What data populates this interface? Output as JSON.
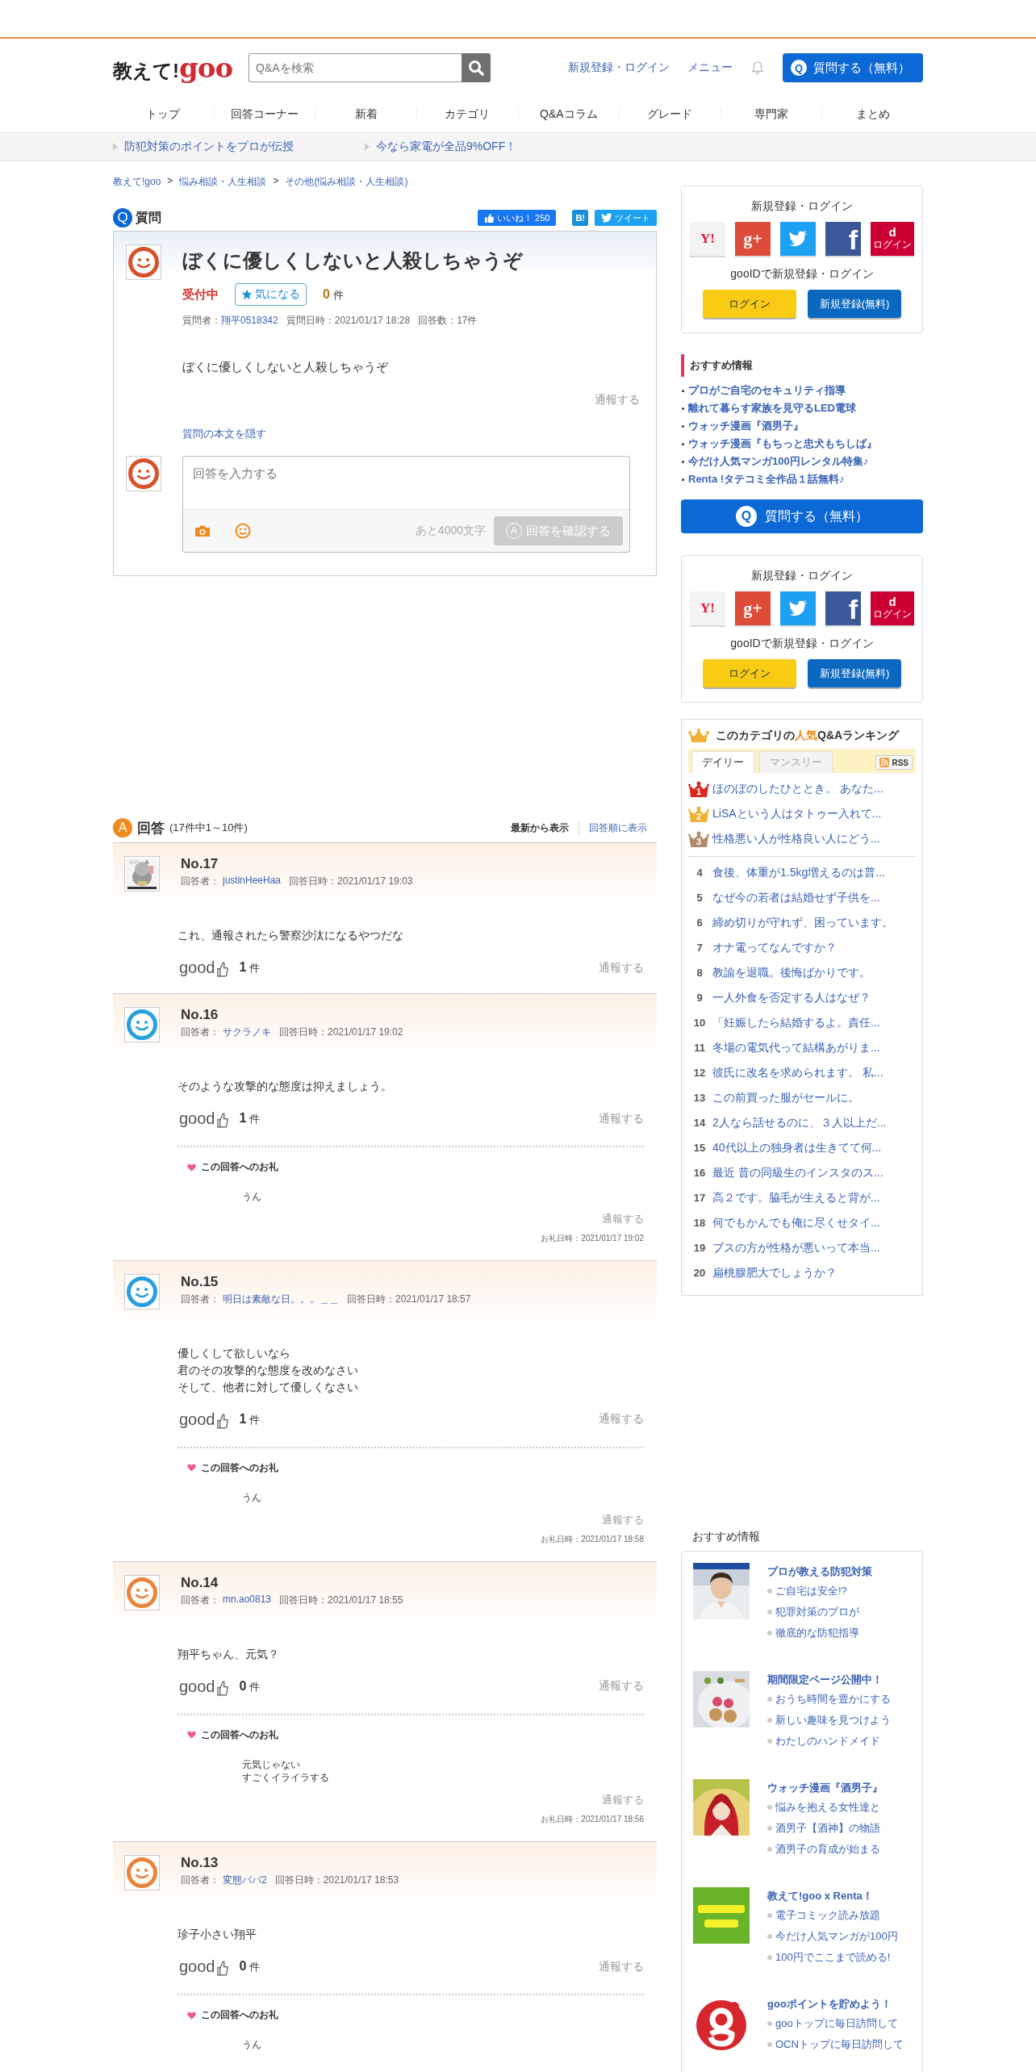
{
  "header": {
    "logo_text": "教えて!",
    "logo_brand": "goo",
    "search": {
      "placeholder": "Q&Aを検索"
    },
    "links": [
      "新規登録・ログイン",
      "メニュー"
    ],
    "ask_button": "質問する（無料）",
    "ask_icon": "Q"
  },
  "nav": [
    "トップ",
    "回答コーナー",
    "新着",
    "カテゴリ",
    "Q&Aコラム",
    "グレード",
    "専門家",
    "まとめ"
  ],
  "promos": [
    "防犯対策のポイントをプロが伝授",
    "今なら家電が全品9%OFF！"
  ],
  "breadcrumb": [
    "教えて!goo",
    "悩み相談・人生相談",
    "その他(悩み相談・人生相談)"
  ],
  "breadcrumb_separator": ">",
  "question": {
    "icon": "Q",
    "heading": "質問",
    "like_label": "いいね！",
    "like_count": "250",
    "hatena": "B!",
    "tweet": "ツイート",
    "title": "ぼくに優しくしないと人殺しちゃうぞ",
    "status": "受付中",
    "watch_label": "気になる",
    "watch_count": "0",
    "watch_unit": "件",
    "asker_label": "質問者：",
    "asker": "翔平0518342",
    "date": "質問日時：2021/01/17 18:28",
    "answer_count": "回答数：17件",
    "body": "ぼくに優しくしないと人殺しちゃうぞ",
    "report": "通報する",
    "hide_link": "質問の本文を隠す",
    "answer_box": {
      "placeholder": "回答を入力する",
      "remaining": "あと4000文字",
      "submit_icon": "A",
      "submit": "回答を確認する"
    }
  },
  "answers_header": {
    "icon": "A",
    "title": "回答",
    "range": "(17件中1～10件)",
    "sort": [
      {
        "label": "最新から表示",
        "selected": true
      },
      {
        "label": "回答順に表示",
        "selected": false
      }
    ]
  },
  "answers": [
    {
      "number": "No.17",
      "avatar": {
        "kind": "picture"
      },
      "answerer_label": "回答者：",
      "answerer": "justinHeeHaa",
      "date": "回答日時：2021/01/17 19:03",
      "body": [
        "これ、通報されたら警察沙汰になるやつだな"
      ],
      "good": "good",
      "good_count": "1",
      "unit": "件",
      "report": "通報する"
    },
    {
      "number": "No.16",
      "avatar": {
        "kind": "smiley",
        "color": "#29a0dc"
      },
      "answerer_label": "回答者：",
      "answerer": "サクラノキ",
      "date": "回答日時：2021/01/17 19:02",
      "body": [
        "そのような攻撃的な態度は抑えましょう。"
      ],
      "good": "good",
      "good_count": "1",
      "unit": "件",
      "report": "通報する",
      "thanks": {
        "title": "この回答へのお礼",
        "body": [
          "うん"
        ],
        "report": "通報する",
        "date": "お礼日時：2021/01/17 19:02"
      }
    },
    {
      "number": "No.15",
      "avatar": {
        "kind": "smiley",
        "color": "#29a0dc"
      },
      "answerer_label": "回答者：",
      "answerer": "明日は素敵な日。。。＿＿",
      "date": "回答日時：2021/01/17 18:57",
      "body": [
        "優しくして欲しいなら",
        "君のその攻撃的な態度を改めなさい",
        "そして、他者に対して優しくなさい"
      ],
      "good": "good",
      "good_count": "1",
      "unit": "件",
      "report": "通報する",
      "thanks": {
        "title": "この回答へのお礼",
        "body": [
          "うん"
        ],
        "report": "通報する",
        "date": "お礼日時：2021/01/17 18:58"
      }
    },
    {
      "number": "No.14",
      "avatar": {
        "kind": "smiley",
        "color": "#e8843c"
      },
      "answerer_label": "回答者：",
      "answerer": "mn.ao0813",
      "date": "回答日時：2021/01/17 18:55",
      "body": [
        "翔平ちゃん、元気？"
      ],
      "good": "good",
      "good_count": "0",
      "unit": "件",
      "report": "通報する",
      "thanks": {
        "title": "この回答へのお礼",
        "body": [
          "元気じゃない",
          "すごくイライラする"
        ],
        "report": "通報する",
        "date": "お礼日時：2021/01/17 18:56"
      }
    },
    {
      "number": "No.13",
      "avatar": {
        "kind": "smiley",
        "color": "#e8843c"
      },
      "answerer_label": "回答者：",
      "answerer": "変態パパ2",
      "date": "回答日時：2021/01/17 18:53",
      "body": [
        "珍子小さい翔平"
      ],
      "good": "good",
      "good_count": "0",
      "unit": "件",
      "report": "通報する",
      "thanks": {
        "title": "この回答へのお礼",
        "body": [
          "うん"
        ]
      }
    }
  ],
  "login_boxes": [
    {
      "title": "新規登録・ログイン",
      "providers": [
        {
          "kind": "yahoo",
          "label": "Y!"
        },
        {
          "kind": "google",
          "label": "g+"
        },
        {
          "kind": "twitter"
        },
        {
          "kind": "facebook",
          "label": "f"
        },
        {
          "kind": "docomo",
          "label": "d",
          "sublabel": "ログイン"
        }
      ],
      "gooid_text": "gooIDで新規登録・ログイン",
      "login_button": "ログイン",
      "register_button": "新規登録(無料)"
    },
    {
      "title": "新規登録・ログイン",
      "providers": [
        {
          "kind": "yahoo",
          "label": "Y!"
        },
        {
          "kind": "google",
          "label": "g+"
        },
        {
          "kind": "twitter"
        },
        {
          "kind": "facebook",
          "label": "f"
        },
        {
          "kind": "docomo",
          "label": "d",
          "sublabel": "ログイン"
        }
      ],
      "gooid_text": "gooIDで新規登録・ログイン",
      "login_button": "ログイン",
      "register_button": "新規登録(無料)"
    }
  ],
  "recommend": {
    "title": "おすすめ情報",
    "items": [
      "プロがご自宅のセキュリティ指導",
      "離れて暮らす家族を見守るLED電球",
      "ウォッチ漫画『酒男子』",
      "ウォッチ漫画『もちっと忠犬もちしば』",
      "今だけ人気マンガ100円レンタル特集♪",
      "Renta !タテコミ全作品１話無料♪"
    ]
  },
  "side_ask_button": {
    "icon": "Q",
    "label": "質問する（無料）"
  },
  "ranking": {
    "title_pre": "このカテゴリの",
    "title_highlight": "人気",
    "title_post": "Q&Aランキング",
    "tabs": [
      {
        "label": "デイリー",
        "selected": true
      },
      {
        "label": "マンスリー",
        "selected": false
      }
    ],
    "rss": "RSS",
    "items": [
      {
        "rank": "1",
        "kind": "crown",
        "color": "#d8281c",
        "title": "ほのぼのしたひととき。 あなた..."
      },
      {
        "rank": "2",
        "kind": "crown",
        "color": "#f0b030",
        "title": "LiSAという人はタトゥー入れて..."
      },
      {
        "rank": "3",
        "kind": "crown",
        "color": "#b08a6a",
        "title": "性格悪い人が性格良い人にどう..."
      },
      {
        "rank": "4",
        "kind": "plain",
        "title": "食後、体重が1.5kg増えるのは普..."
      },
      {
        "rank": "5",
        "kind": "plain",
        "title": "なぜ今の若者は結婚せず子供を..."
      },
      {
        "rank": "6",
        "kind": "plain",
        "title": "締め切りが守れず、困っています。"
      },
      {
        "rank": "7",
        "kind": "plain",
        "title": "オナ電ってなんですか？"
      },
      {
        "rank": "8",
        "kind": "plain",
        "title": "教諭を退職。後悔ばかりです。"
      },
      {
        "rank": "9",
        "kind": "plain",
        "title": "一人外食を否定する人はなぜ？"
      },
      {
        "rank": "10",
        "kind": "plain",
        "title": "「妊娠したら結婚するよ。責任..."
      },
      {
        "rank": "11",
        "kind": "plain",
        "title": "冬場の電気代って結構あがりま..."
      },
      {
        "rank": "12",
        "kind": "plain",
        "title": "彼氏に改名を求められます。 私..."
      },
      {
        "rank": "13",
        "kind": "plain",
        "title": "この前買った服がセールに。"
      },
      {
        "rank": "14",
        "kind": "plain",
        "title": "2人なら話せるのに、３人以上だ..."
      },
      {
        "rank": "15",
        "kind": "plain",
        "title": "40代以上の独身者は生きてて何..."
      },
      {
        "rank": "16",
        "kind": "plain",
        "title": "最近 昔の同級生のインスタのス..."
      },
      {
        "rank": "17",
        "kind": "plain",
        "title": "高２です。脇毛が生えると背が..."
      },
      {
        "rank": "18",
        "kind": "plain",
        "title": "何でもかんでも俺に尽くせタイ..."
      },
      {
        "rank": "19",
        "kind": "plain",
        "title": "ブスの方が性格が悪いって本当..."
      },
      {
        "rank": "20",
        "kind": "plain",
        "title": "扁桃腺肥大でしょうか？"
      }
    ]
  },
  "features": {
    "title": "おすすめ情報",
    "items": [
      {
        "image": {
          "kind": "picture"
        },
        "title": "プロが教える防犯対策",
        "links": [
          "ご自宅は安全!?",
          "犯罪対策のプロが",
          "徹底的な防犯指導"
        ]
      },
      {
        "image": {
          "kind": "picture"
        },
        "title": "期間限定ページ公開中！",
        "links": [
          "おうち時間を豊かにする",
          "新しい趣味を見つけよう",
          "わたしのハンドメイド"
        ]
      },
      {
        "image": {
          "kind": "picture"
        },
        "title": "ウォッチ漫画『酒男子』",
        "links": [
          "悩みを抱える女性達と",
          "酒男子【酒神】の物語",
          "酒男子の育成が始まる"
        ]
      },
      {
        "image": {
          "kind": "picture"
        },
        "title": "教えて!goo x Renta！",
        "links": [
          "電子コミック読み放題",
          "今だけ人気マンガが100円",
          "100円でここまで読める!"
        ]
      },
      {
        "image": {
          "kind": "logo"
        },
        "title": "gooポイントを貯めよう！",
        "links": [
          "gooトップに毎日訪問して",
          "OCNトップに毎日訪問して"
        ]
      }
    ]
  }
}
